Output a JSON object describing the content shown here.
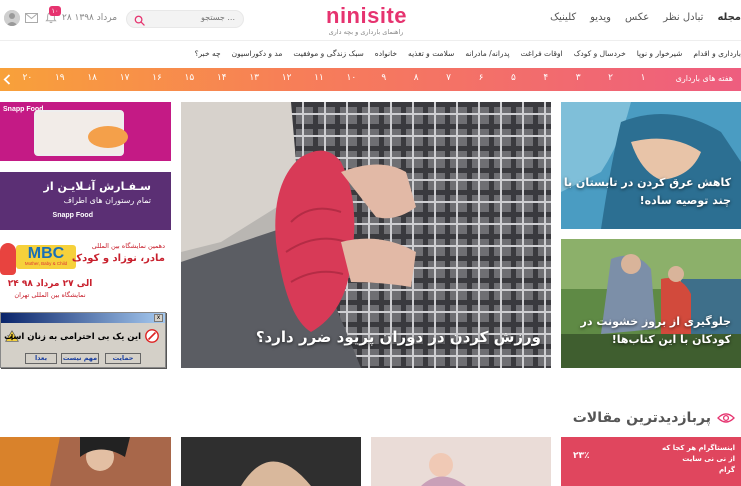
{
  "header": {
    "nav": [
      "مجله",
      "تبادل نظر",
      "عکس",
      "ویدیو",
      "کلینیک"
    ],
    "logo": {
      "name": "ninisite",
      "tagline": "راهنمای بارداری و بچه داری"
    },
    "search_placeholder": "جستجو ...",
    "date": "۲۸ مرداد ۱۳۹۸",
    "notification_count": "۱۰",
    "icons": [
      "search-icon",
      "mail-icon",
      "bell-icon",
      "avatar"
    ],
    "accent_color": "#e6336f"
  },
  "categories": [
    "بارداری و اقدام",
    "شیرخوار و نوپا",
    "خردسال و کودک",
    "اوقات فراغت",
    "پدرانه/ مادرانه",
    "سلامت و تغذیه",
    "خانواده",
    "سبک زندگی و موفقیت",
    "مد و دکوراسیون",
    "چه خبر؟"
  ],
  "weeks": {
    "title": "هفته های بارداری",
    "numbers": [
      "۱",
      "۲",
      "۳",
      "۴",
      "۵",
      "۶",
      "۷",
      "۸",
      "۹",
      "۱۰",
      "۱۱",
      "۱۲",
      "۱۳",
      "۱۴",
      "۱۵",
      "۱۶",
      "۱۷",
      "۱۸",
      "۱۹",
      "۲۰"
    ],
    "gradient": [
      "#f8a13a",
      "#ee5d7f"
    ]
  },
  "ads": {
    "snapp_food_1": {
      "brand": "Snapp Food"
    },
    "snapp_food_2": {
      "line1": "سـفـارش آنـلایـن از",
      "line2": "تمام رستوران های اطراف",
      "brand": "Snapp Food"
    },
    "mbc": {
      "logo": "MBC",
      "logo_sub": "Mother, Baby & Child",
      "line1": "دهمین نمایشگاه بین المللی",
      "line2": "مادر، نوزاد و کودک",
      "line3": "۲۴ الی ۲۷ مرداد ۹۸",
      "line4": "نمایشگاه بین المللی تهران"
    },
    "dialog": {
      "message": "این یک بی احترامی به زنان است",
      "buttons": [
        "حمایت",
        "مهم نیست",
        "بعدا"
      ]
    }
  },
  "articles": {
    "hero": {
      "title": "ورزش کردن در دوران پریود ضرر دارد؟"
    },
    "side1": {
      "title": "کاهش عرق کردن در تابستان با چند توصیه ساده!"
    },
    "side2": {
      "title": "جلوگیری از بروز خشونت در کودکان با این کتاب‌ها!"
    }
  },
  "most_viewed": {
    "title": "پربازدیدترین مقالات",
    "card4_text": [
      "اینستاگرام هر کجا که",
      "از نی نی سایت",
      "گرام"
    ],
    "card4_badge": "۲۳٪"
  }
}
